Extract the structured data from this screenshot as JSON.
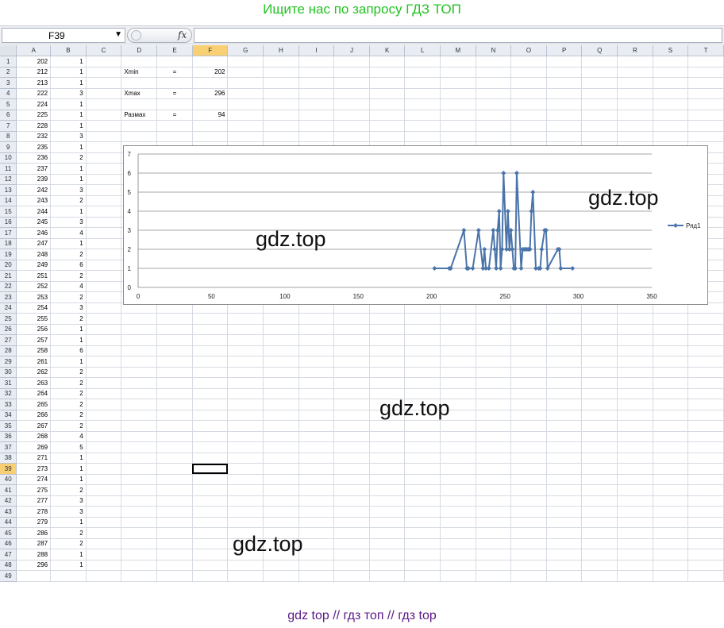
{
  "top_banner": "Ищите нас по запросу ГДЗ ТОП",
  "bottom_banner": "gdz top  //  гдз топ  //  гдз top",
  "watermark": "gdz.top",
  "formula_bar": {
    "name_box": "F39",
    "fx_label": "fx",
    "formula": ""
  },
  "columns": [
    "A",
    "B",
    "C",
    "D",
    "E",
    "F",
    "G",
    "H",
    "I",
    "J",
    "K",
    "L",
    "M",
    "N",
    "O",
    "P",
    "Q",
    "R",
    "S",
    "T"
  ],
  "selected_column": "F",
  "selected_row": 39,
  "row_count": 49,
  "column_a": [
    202,
    212,
    213,
    222,
    224,
    225,
    228,
    232,
    235,
    236,
    237,
    239,
    242,
    243,
    244,
    245,
    246,
    247,
    248,
    249,
    251,
    252,
    253,
    254,
    255,
    256,
    257,
    258,
    261,
    262,
    263,
    264,
    265,
    266,
    267,
    268,
    269,
    271,
    273,
    274,
    275,
    277,
    278,
    279,
    286,
    287,
    288,
    296
  ],
  "column_b": [
    1,
    1,
    1,
    3,
    1,
    1,
    1,
    3,
    1,
    2,
    1,
    1,
    3,
    2,
    1,
    3,
    4,
    1,
    2,
    6,
    2,
    4,
    2,
    3,
    2,
    1,
    1,
    6,
    1,
    2,
    2,
    2,
    2,
    2,
    2,
    4,
    5,
    1,
    1,
    1,
    2,
    3,
    3,
    1,
    2,
    2,
    1,
    1
  ],
  "stats": [
    {
      "row": 2,
      "label": "Xmin",
      "eq": "=",
      "value": "202"
    },
    {
      "row": 4,
      "label": "Xmax",
      "eq": "=",
      "value": "296"
    },
    {
      "row": 6,
      "label": "Размах",
      "eq": "=",
      "value": "94"
    }
  ],
  "chart_data": {
    "type": "line",
    "x": [
      202,
      212,
      213,
      222,
      224,
      225,
      228,
      232,
      235,
      236,
      237,
      239,
      242,
      243,
      244,
      245,
      246,
      247,
      248,
      249,
      251,
      252,
      253,
      254,
      255,
      256,
      257,
      258,
      261,
      262,
      263,
      264,
      265,
      266,
      267,
      268,
      269,
      271,
      273,
      274,
      275,
      277,
      278,
      279,
      286,
      287,
      288,
      296
    ],
    "series": [
      {
        "name": "Ряд1",
        "values": [
          1,
          1,
          1,
          3,
          1,
          1,
          1,
          3,
          1,
          2,
          1,
          1,
          3,
          2,
          1,
          3,
          4,
          1,
          2,
          6,
          2,
          4,
          2,
          3,
          2,
          1,
          1,
          6,
          1,
          2,
          2,
          2,
          2,
          2,
          2,
          4,
          5,
          1,
          1,
          1,
          2,
          3,
          3,
          1,
          2,
          2,
          1,
          1
        ],
        "color": "#4a74aa"
      }
    ],
    "xlim": [
      0,
      350
    ],
    "ylim": [
      0,
      7
    ],
    "xticks": [
      0,
      50,
      100,
      150,
      200,
      250,
      300,
      350
    ],
    "yticks": [
      0,
      1,
      2,
      3,
      4,
      5,
      6,
      7
    ],
    "grid": "horizontal",
    "legend": "right"
  }
}
